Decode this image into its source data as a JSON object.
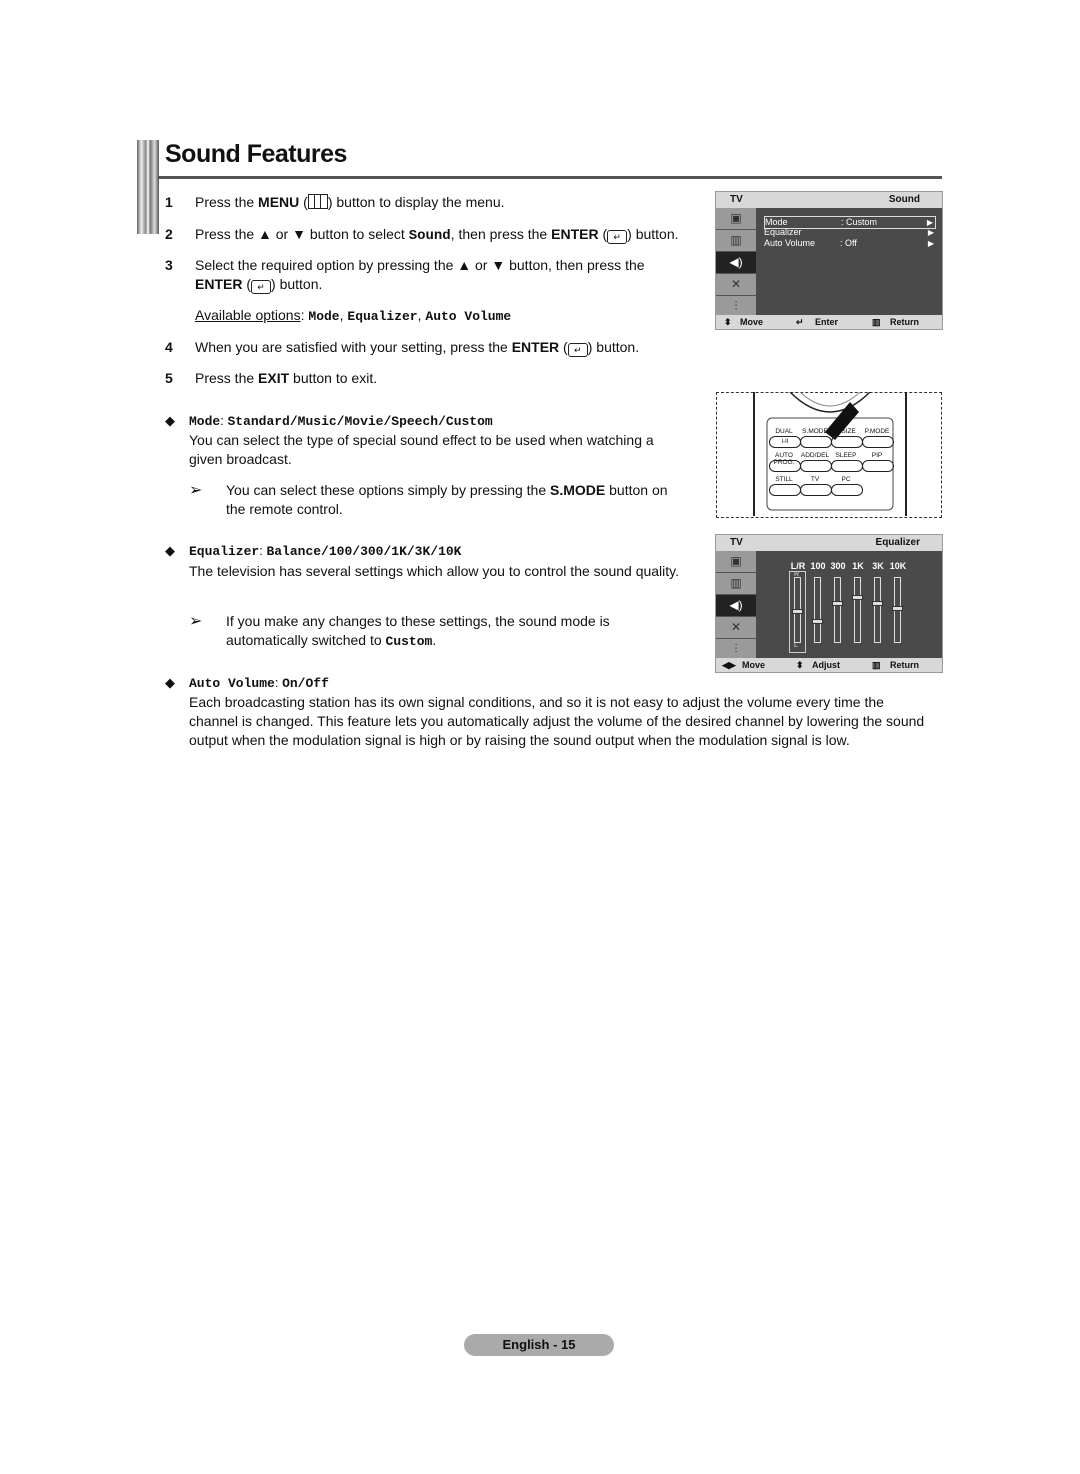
{
  "page": {
    "title": "Sound Features",
    "footer": "English - 15"
  },
  "steps": [
    {
      "num": "1",
      "pre": "Press the ",
      "bold": "MENU",
      "mid": " (",
      "icon": "menu-icon",
      "post": ") button to display the menu."
    },
    {
      "num": "2",
      "pre": "Press the ▲ or ▼ button to select ",
      "code": "Sound",
      "mid": ", then press the ",
      "bold": "ENTER",
      "post": ") button."
    },
    {
      "num": "3",
      "line1": "Select the required option by pressing the ▲ or ▼ button, then press the",
      "bold": "ENTER",
      "post": ") button."
    },
    {
      "num": "4",
      "pre": "When you are satisfied with your setting, press the ",
      "bold": "ENTER",
      "post": ") button."
    },
    {
      "num": "5",
      "pre": "Press the ",
      "bold": "EXIT",
      "post": " button to exit."
    }
  ],
  "available": {
    "label": "Available options",
    "options": [
      "Mode",
      "Equalizer",
      "Auto Volume"
    ]
  },
  "sections": [
    {
      "name": "Mode",
      "values": "Standard/Music/Movie/Speech/Custom",
      "body": "You can select the type of special sound effect to be used when watching a given broadcast.",
      "note_pre": "You can select these options simply by pressing the ",
      "note_bold": "S.MODE",
      "note_post": " button on the remote control."
    },
    {
      "name": "Equalizer",
      "values": "Balance/100/300/1K/3K/10K",
      "body": "The television has several settings which allow you to control the sound quality.",
      "note_pre": "If you make any changes to these settings, the sound mode is automatically switched to ",
      "note_code": "Custom",
      "note_post": "."
    },
    {
      "name": "Auto Volume",
      "values": "On/Off",
      "body": "Each broadcasting station has its own signal conditions, and so it is not easy to adjust the volume every time the channel is changed. This feature lets you automatically adjust the volume of the desired channel by lowering the sound output when the modulation signal is high or by raising the sound output when the modulation signal is low."
    }
  ],
  "osd_sound": {
    "source": "TV",
    "title": "Sound",
    "rows": [
      {
        "label": "Mode",
        "value": ": Custom",
        "selected": true
      },
      {
        "label": "Equalizer",
        "value": "",
        "selected": false
      },
      {
        "label": "Auto Volume",
        "value": ": Off",
        "selected": false
      }
    ],
    "footer": {
      "move": "Move",
      "enter": "Enter",
      "return": "Return"
    }
  },
  "osd_eq": {
    "source": "TV",
    "title": "Equalizer",
    "bands": [
      {
        "label": "L/R",
        "level": 0.5,
        "top_mark": "R",
        "bottom_mark": "L"
      },
      {
        "label": "100",
        "level": 0.35
      },
      {
        "label": "300",
        "level": 0.62
      },
      {
        "label": "1K",
        "level": 0.72
      },
      {
        "label": "3K",
        "level": 0.62
      },
      {
        "label": "10K",
        "level": 0.55
      }
    ],
    "footer": {
      "move": "Move",
      "adjust": "Adjust",
      "return": "Return"
    }
  },
  "remote": {
    "rows": [
      [
        "DUAL",
        "S.MODE",
        "P.SIZE",
        "P.MODE"
      ],
      [
        "AUTO PROG.",
        "ADD/DEL",
        "SLEEP",
        "PIP"
      ],
      [
        "STILL",
        "TV",
        "PC"
      ]
    ],
    "dual_glyph": "I-II"
  }
}
